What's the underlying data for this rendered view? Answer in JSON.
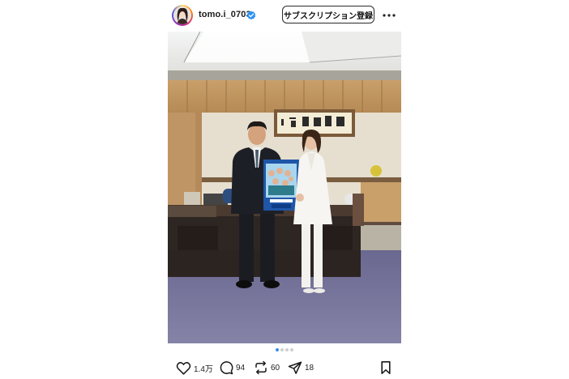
{
  "post": {
    "username": "tomo.i_0703",
    "subscribe_label": "サブスクリプション登録",
    "image_alt": "two people holding a poster in an office"
  },
  "carousel": {
    "total": 4,
    "active": 1
  },
  "actions": {
    "likes": "1.4万",
    "comments": "94",
    "reposts": "60",
    "shares": "18"
  },
  "colors": {
    "verified": "#2b93f5",
    "dot_active": "#3a8fe8",
    "dot_inactive": "#cfcfcf"
  },
  "icons": [
    "heart-icon",
    "comment-icon",
    "repost-icon",
    "share-icon",
    "bookmark-icon",
    "more-icon",
    "verified-badge-icon"
  ]
}
